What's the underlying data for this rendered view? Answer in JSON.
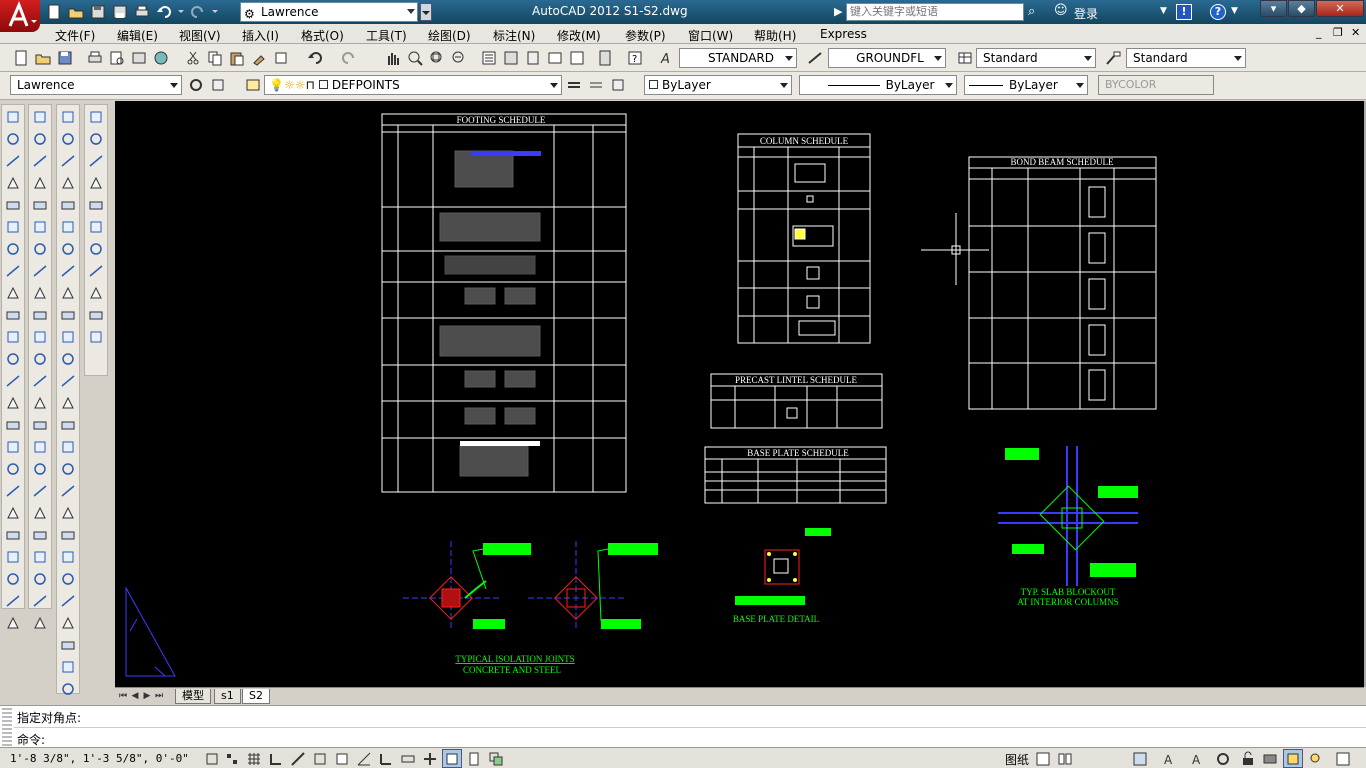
{
  "title_bar": {
    "workspace": "Lawrence",
    "app_title": "AutoCAD 2012    S1-S2.dwg",
    "search_placeholder": "键入关键字或短语",
    "login": "登录"
  },
  "menu": [
    "文件(F)",
    "编辑(E)",
    "视图(V)",
    "插入(I)",
    "格式(O)",
    "工具(T)",
    "绘图(D)",
    "标注(N)",
    "修改(M)",
    "参数(P)",
    "窗口(W)",
    "帮助(H)",
    "Express"
  ],
  "styles_toolbar": {
    "text_style": "STANDARD",
    "dim_style": "GROUNDFL",
    "table_style": "Standard",
    "mleader_style": "Standard"
  },
  "layers_toolbar": {
    "workspace": "Lawrence",
    "layer": "DEFPOINTS",
    "color": "ByLayer",
    "linetype": "ByLayer",
    "lineweight": "ByLayer",
    "plotstyle": "BYCOLOR"
  },
  "drawing": {
    "footing_title": "FOOTING SCHEDULE",
    "column_title": "COLUMN SCHEDULE",
    "bond_beam_title": "BOND BEAM SCHEDULE",
    "lintel_title": "PRECAST LINTEL SCHEDULE",
    "base_plate_title": "BASE PLATE SCHEDULE",
    "isolation_label_1": "TYPICAL ISOLATION JOINTS",
    "isolation_label_2": "CONCRETE AND STEEL",
    "base_plate_detail": "BASE PLATE DETAIL",
    "slab_label_1": "TYP. SLAB BLOCKOUT",
    "slab_label_2": "AT INTERIOR COLUMNS"
  },
  "layout_tabs": [
    "模型",
    "s1",
    "S2"
  ],
  "command": {
    "history": "指定对角点:",
    "prompt": "命令:"
  },
  "status": {
    "coords": "1'-8 3/8\",  1'-3 5/8\",  0'-0\"",
    "model_label": "图纸"
  },
  "colors": {
    "canvas": "#000000",
    "title_bar": "#1d5573",
    "cad_green": "#00ff00",
    "cad_white": "#ffffff",
    "cad_blue": "#3b3bff",
    "cad_red": "#ff2020"
  }
}
